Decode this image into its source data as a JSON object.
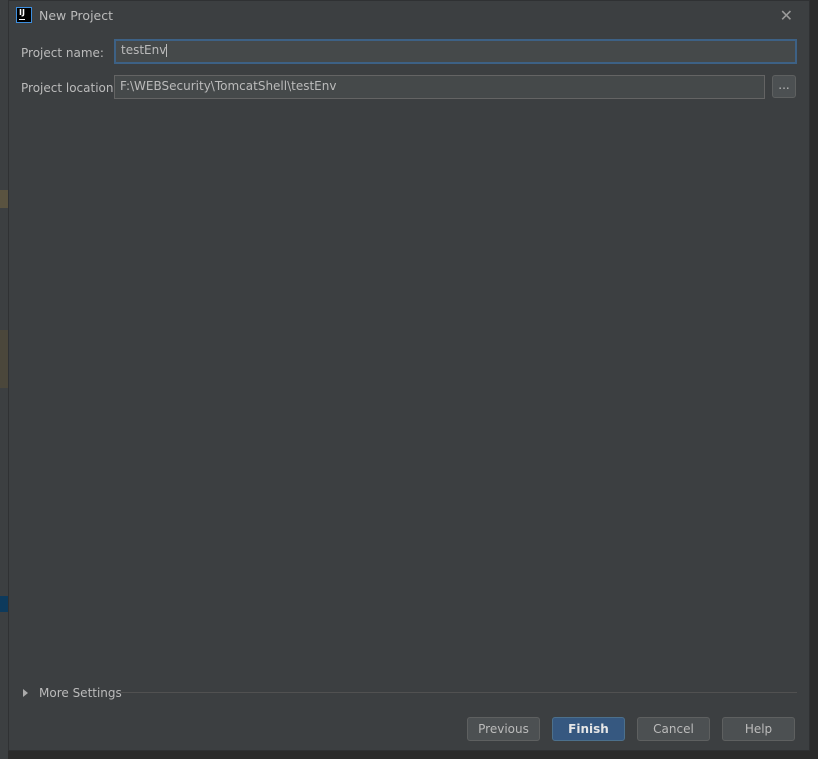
{
  "dialog": {
    "title": "New Project",
    "icon": "intellij-idea-icon",
    "close_icon": "close-icon"
  },
  "form": {
    "project_name_label": "Project name:",
    "project_name_value": "testEnv",
    "project_location_label": "Project location:",
    "project_location_value": "F:\\WEBSecurity\\TomcatShell\\testEnv",
    "browse_label": "..."
  },
  "more_settings": {
    "label": "More Settings",
    "expanded": false
  },
  "buttons": {
    "previous": "Previous",
    "finish": "Finish",
    "cancel": "Cancel",
    "help": "Help"
  },
  "colors": {
    "accent": "#365880",
    "focus_border": "#3d6185",
    "background": "#3c3f41"
  }
}
